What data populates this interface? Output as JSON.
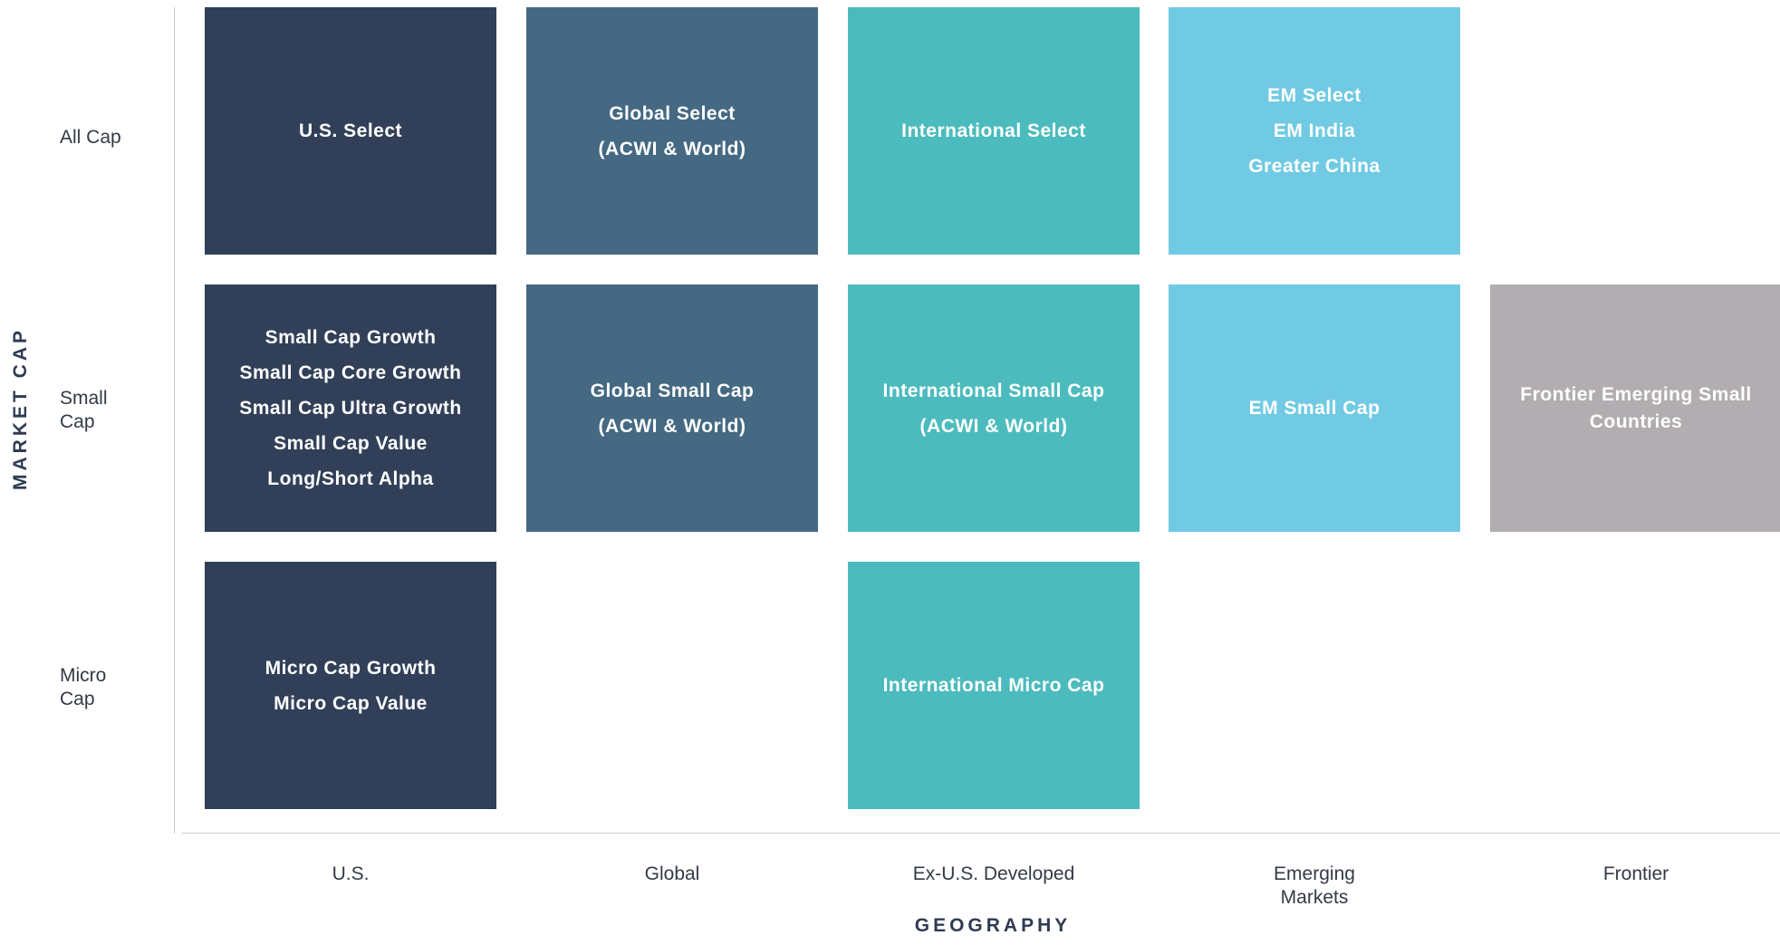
{
  "axes": {
    "y_title": "MARKET CAP",
    "x_title": "GEOGRAPHY",
    "rows": [
      "All Cap",
      "Small Cap",
      "Micro Cap"
    ],
    "columns": [
      "U.S.",
      "Global",
      "Ex-U.S. Developed",
      "Emerging Markets",
      "Frontier"
    ]
  },
  "row_labels": {
    "all_cap": "All Cap",
    "small_cap": [
      "Small",
      "Cap"
    ],
    "micro_cap": [
      "Micro",
      "Cap"
    ]
  },
  "column_labels": {
    "us": "U.S.",
    "global": "Global",
    "exus": "Ex-U.S. Developed",
    "em": [
      "Emerging",
      "Markets"
    ],
    "frontier": "Frontier"
  },
  "colors": {
    "us": "#314058",
    "global": "#456982",
    "exus": "#4cbbbd",
    "em": "#71cae3",
    "frontier": "#b1adb0"
  },
  "cells": {
    "allcap_us": [
      "U.S. Select"
    ],
    "allcap_global": [
      "Global Select",
      "(ACWI & World)"
    ],
    "allcap_exus": [
      "International Select"
    ],
    "allcap_em": [
      "EM Select",
      "EM India",
      "Greater China"
    ],
    "smallcap_us": [
      "Small Cap Growth",
      "Small Cap Core Growth",
      "Small Cap Ultra Growth",
      "Small Cap Value",
      "Long/Short Alpha"
    ],
    "smallcap_global": [
      "Global Small Cap",
      "(ACWI & World)"
    ],
    "smallcap_exus": [
      "International Small Cap",
      "(ACWI & World)"
    ],
    "smallcap_em": [
      "EM Small Cap"
    ],
    "smallcap_frontier": [
      "Frontier Emerging Small",
      "Countries"
    ],
    "microcap_us": [
      "Micro Cap Growth",
      "Micro Cap Value"
    ],
    "microcap_exus": [
      "International Micro Cap"
    ]
  }
}
